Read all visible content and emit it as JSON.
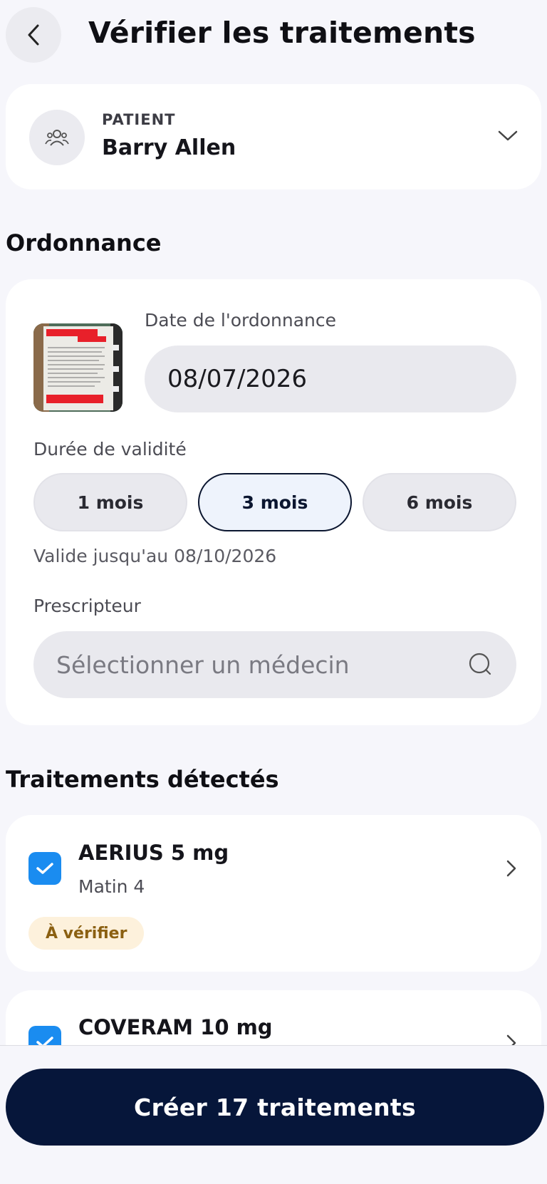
{
  "header": {
    "title": "Vérifier les traitements",
    "back_icon": "chevron-left-icon"
  },
  "patient": {
    "label": "PATIENT",
    "name": "Barry Allen",
    "avatar_icon": "users-icon",
    "expand_icon": "chevron-down-icon"
  },
  "prescription": {
    "section_title": "Ordonnance",
    "date_label": "Date de l'ordonnance",
    "date_value": "08/07/2026",
    "validity_label": "Durée de validité",
    "validity_options": [
      {
        "label": "1 mois",
        "selected": false
      },
      {
        "label": "3 mois",
        "selected": true
      },
      {
        "label": "6 mois",
        "selected": false
      }
    ],
    "valid_until": "Valide jusqu'au 08/10/2026",
    "prescriber_label": "Prescripteur",
    "prescriber_placeholder": "Sélectionner un médecin"
  },
  "treatments": {
    "section_title": "Traitements détectés",
    "items": [
      {
        "name": "AERIUS 5 mg",
        "dose": "Matin 4",
        "badge": "À vérifier",
        "checked": true
      },
      {
        "name": "COVERAM 10 mg",
        "checked": true
      }
    ]
  },
  "footer": {
    "create_button": "Créer 17 traitements"
  },
  "colors": {
    "accent": "#1a8cf0",
    "primary_dark": "#06163a",
    "badge_bg": "#fdf1dc",
    "badge_text": "#8b6012"
  }
}
